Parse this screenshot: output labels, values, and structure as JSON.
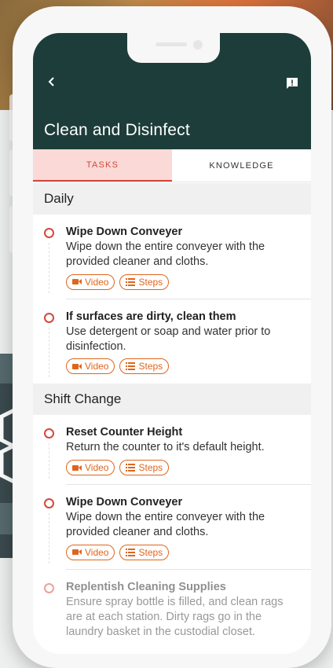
{
  "header": {
    "title": "Clean and Disinfect",
    "back_icon": "chevron-left-icon",
    "report_icon": "report-icon"
  },
  "tabs": [
    {
      "label": "TASKS",
      "active": true
    },
    {
      "label": "KNOWLEDGE",
      "active": false
    }
  ],
  "chip_labels": {
    "video": "Video",
    "steps": "Steps"
  },
  "sections": [
    {
      "title": "Daily",
      "tasks": [
        {
          "name": "Wipe Down Conveyer",
          "desc": "Wipe down the entire conveyer with the provided cleaner and cloths."
        },
        {
          "name": "If surfaces are dirty, clean them",
          "desc": "Use detergent or soap and water prior to disinfection."
        }
      ]
    },
    {
      "title": "Shift Change",
      "tasks": [
        {
          "name": "Reset Counter Height",
          "desc": "Return the counter to it's default height."
        },
        {
          "name": "Wipe Down Conveyer",
          "desc": "Wipe down the entire conveyer with the provided cleaner and cloths."
        },
        {
          "name": "Replentish Cleaning Supplies",
          "desc": "Ensure spray bottle is filled, and clean rags are at each station. Dirty rags go in the laundry basket in the custodial closet."
        }
      ]
    }
  ],
  "colors": {
    "header_bg": "#1d3d3a",
    "accent": "#d4483c",
    "chip": "#e0651c",
    "tab_active_bg": "#fbd9d6"
  }
}
